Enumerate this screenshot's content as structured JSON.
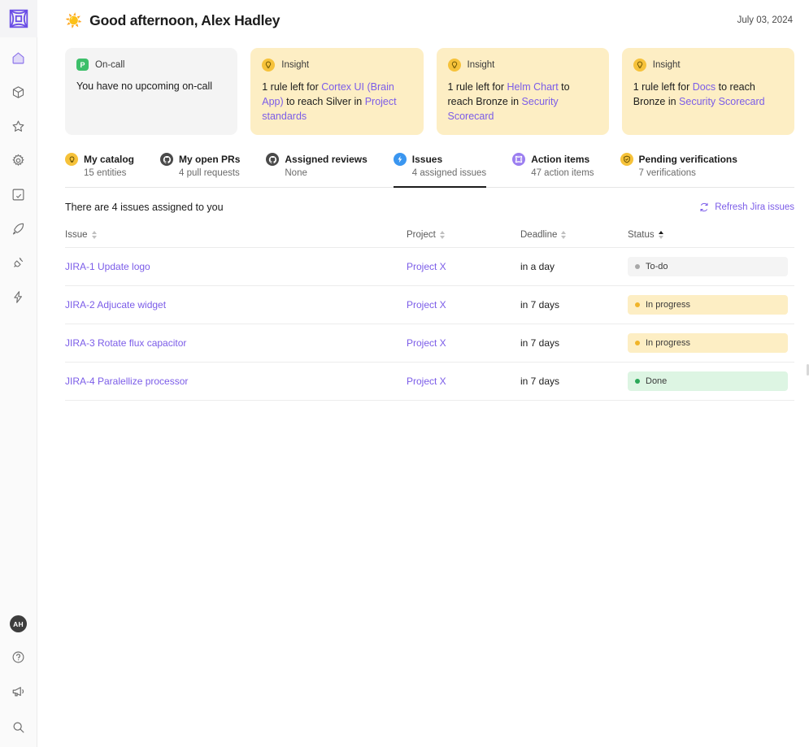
{
  "app": {
    "logo_icon": "cortex-logo-icon"
  },
  "sidebar": {
    "nav_items": [
      {
        "name": "home",
        "icon": "home-icon"
      },
      {
        "name": "catalog",
        "icon": "cube-icon"
      },
      {
        "name": "scorecards",
        "icon": "star-icon"
      },
      {
        "name": "settings",
        "icon": "gear-icon"
      },
      {
        "name": "plugins",
        "icon": "window-check-icon"
      },
      {
        "name": "initiatives",
        "icon": "rocket-icon"
      },
      {
        "name": "integrations",
        "icon": "plug-icon"
      },
      {
        "name": "workflows",
        "icon": "lightning-icon"
      }
    ],
    "bottom_items": [
      {
        "name": "user-avatar",
        "icon": "avatar",
        "label": "AH"
      },
      {
        "name": "help",
        "icon": "question-circle-icon"
      },
      {
        "name": "announcements",
        "icon": "megaphone-icon"
      },
      {
        "name": "search",
        "icon": "magnifier-icon"
      }
    ]
  },
  "header": {
    "emoji": "☀️",
    "greeting": "Good afternoon, Alex Hadley",
    "date": "July 03, 2024"
  },
  "cards": [
    {
      "type": "oncall",
      "icon": "pagerduty-icon",
      "icon_letter": "P",
      "title": "On-call",
      "body_parts": [
        {
          "text": "You have no upcoming on-call",
          "link": false
        }
      ]
    },
    {
      "type": "insight",
      "icon": "lightbulb-icon",
      "title": "Insight",
      "body_parts": [
        {
          "text": "1 rule left for ",
          "link": false
        },
        {
          "text": "Cortex UI (Brain App)",
          "link": true
        },
        {
          "text": " to reach Silver in ",
          "link": false
        },
        {
          "text": "Project standards",
          "link": true
        }
      ]
    },
    {
      "type": "insight",
      "icon": "lightbulb-icon",
      "title": "Insight",
      "body_parts": [
        {
          "text": "1 rule left for ",
          "link": false
        },
        {
          "text": "Helm Chart",
          "link": true
        },
        {
          "text": " to reach Bronze in ",
          "link": false
        },
        {
          "text": "Security Scorecard",
          "link": true
        }
      ]
    },
    {
      "type": "insight",
      "icon": "lightbulb-icon",
      "title": "Insight",
      "body_parts": [
        {
          "text": "1 rule left for ",
          "link": false
        },
        {
          "text": "Docs",
          "link": true
        },
        {
          "text": " to reach Bronze in ",
          "link": false
        },
        {
          "text": "Security Scorecard",
          "link": true
        }
      ]
    }
  ],
  "tabs": [
    {
      "id": "my-catalog",
      "label": "My catalog",
      "sub": "15 entities",
      "icon": "lightbulb-icon",
      "icon_style": "yellow",
      "active": false
    },
    {
      "id": "my-open-prs",
      "label": "My open PRs",
      "sub": "4 pull requests",
      "icon": "github-icon",
      "icon_style": "dark",
      "active": false
    },
    {
      "id": "assigned-reviews",
      "label": "Assigned reviews",
      "sub": "None",
      "icon": "github-icon",
      "icon_style": "dark",
      "active": false
    },
    {
      "id": "issues",
      "label": "Issues",
      "sub": "4 assigned issues",
      "icon": "jira-icon",
      "icon_style": "blue",
      "active": true
    },
    {
      "id": "action-items",
      "label": "Action items",
      "sub": "47 action items",
      "icon": "cortex-icon",
      "icon_style": "purple",
      "active": false
    },
    {
      "id": "pending-verifications",
      "label": "Pending verifications",
      "sub": "7 verifications",
      "icon": "shield-check-icon",
      "icon_style": "yellow",
      "active": false
    }
  ],
  "issues_panel": {
    "summary": "There are 4 issues assigned to you",
    "refresh_label": "Refresh Jira issues",
    "refresh_icon": "refresh-icon",
    "columns": [
      {
        "key": "issue",
        "label": "Issue",
        "sort": "none"
      },
      {
        "key": "project",
        "label": "Project",
        "sort": "none"
      },
      {
        "key": "deadline",
        "label": "Deadline",
        "sort": "none"
      },
      {
        "key": "status",
        "label": "Status",
        "sort": "asc"
      }
    ],
    "rows": [
      {
        "issue": "JIRA-1 Update logo",
        "project": "Project X",
        "deadline": "in a day",
        "status": "To-do",
        "status_style": "todo"
      },
      {
        "issue": "JIRA-2 Adjucate widget",
        "project": "Project X",
        "deadline": "in 7 days",
        "status": "In progress",
        "status_style": "prog"
      },
      {
        "issue": "JIRA-3 Rotate flux capacitor",
        "project": "Project X",
        "deadline": "in 7 days",
        "status": "In progress",
        "status_style": "prog"
      },
      {
        "issue": "JIRA-4 Paralellize processor",
        "project": "Project X",
        "deadline": "in 7 days",
        "status": "Done",
        "status_style": "done"
      }
    ]
  },
  "colors": {
    "accent": "#7b5ce8",
    "insight_bg": "#fdeec4",
    "status_todo": "#a8a8a8",
    "status_progress": "#f0b429",
    "status_done": "#2aa858"
  }
}
